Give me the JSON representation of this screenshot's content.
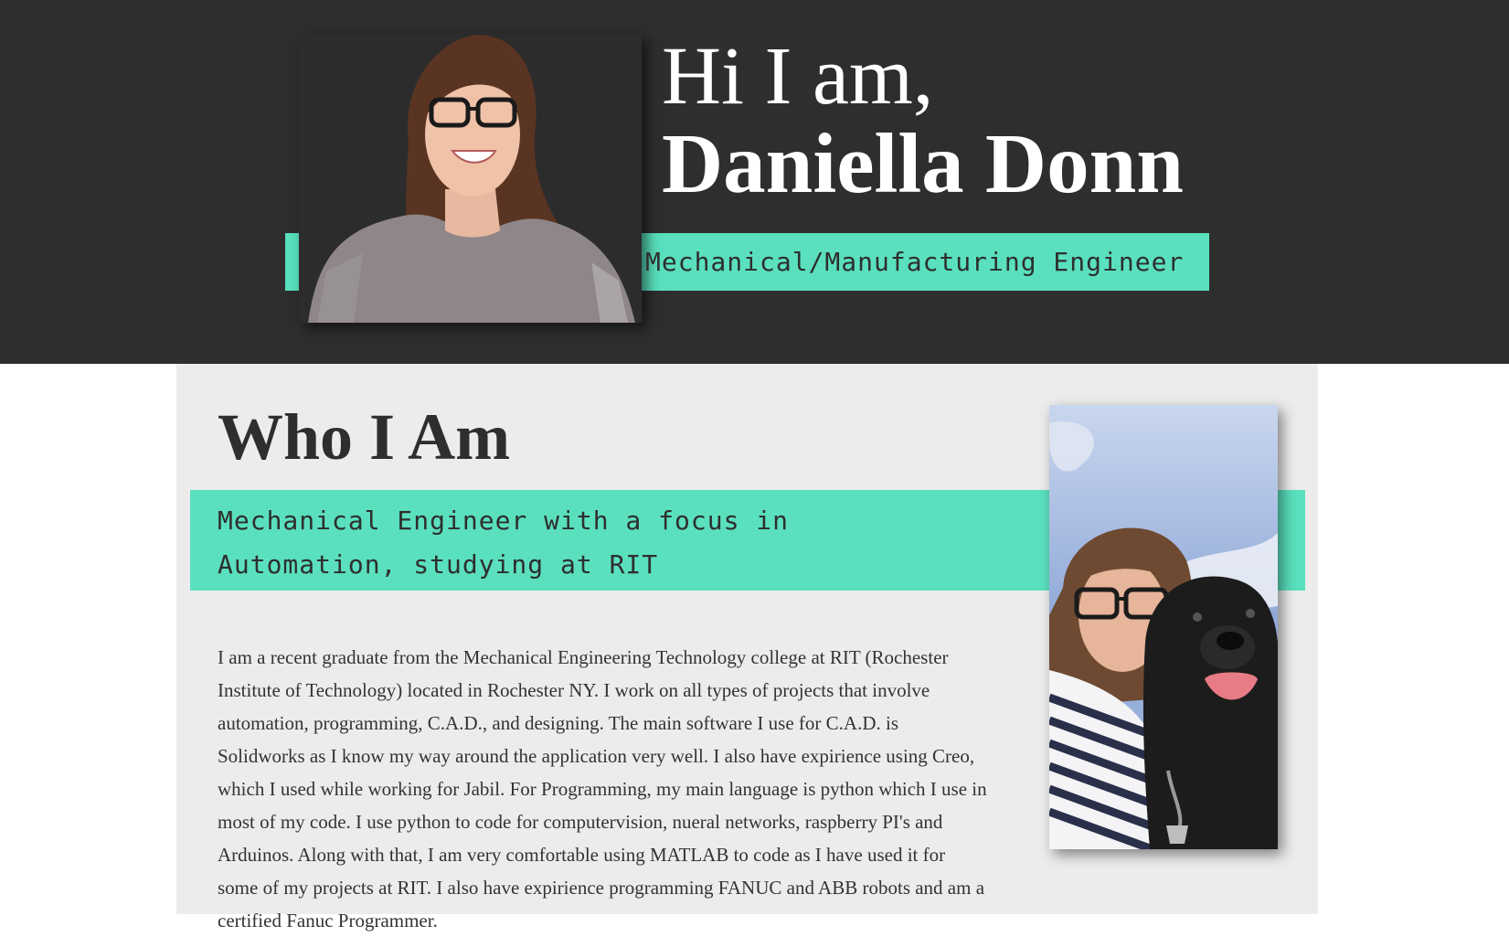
{
  "hero": {
    "greeting": "Hi I am,",
    "name": "Daniella Donn",
    "role": "Mechanical/Manufacturing Engineer",
    "accent_color": "#5ae0be",
    "background_color": "#2e2e2e"
  },
  "about": {
    "title": "Who I Am",
    "subtitle": "Mechanical Engineer with a focus in Automation, studying at RIT",
    "body": "I am a recent graduate from the Mechanical Engineering Technology college at RIT (Rochester Institute of Technology) located in Rochester NY. I work on all types of projects that involve automation, programming, C.A.D., and designing. The main software I use for C.A.D. is Solidworks as I know my way around the application very well. I also have expirience using Creo, which I used while working for Jabil. For Programming, my main language is python which I use in most of my code. I use python to code for computervision, nueral networks, raspberry PI's and Arduinos. Along with that, I am very comfortable using MATLAB to code as I have used it for some of my projects at RIT. I also have expirience programming FANUC and ABB robots and am a certified Fanuc Programmer.",
    "background_color": "#ececec"
  }
}
